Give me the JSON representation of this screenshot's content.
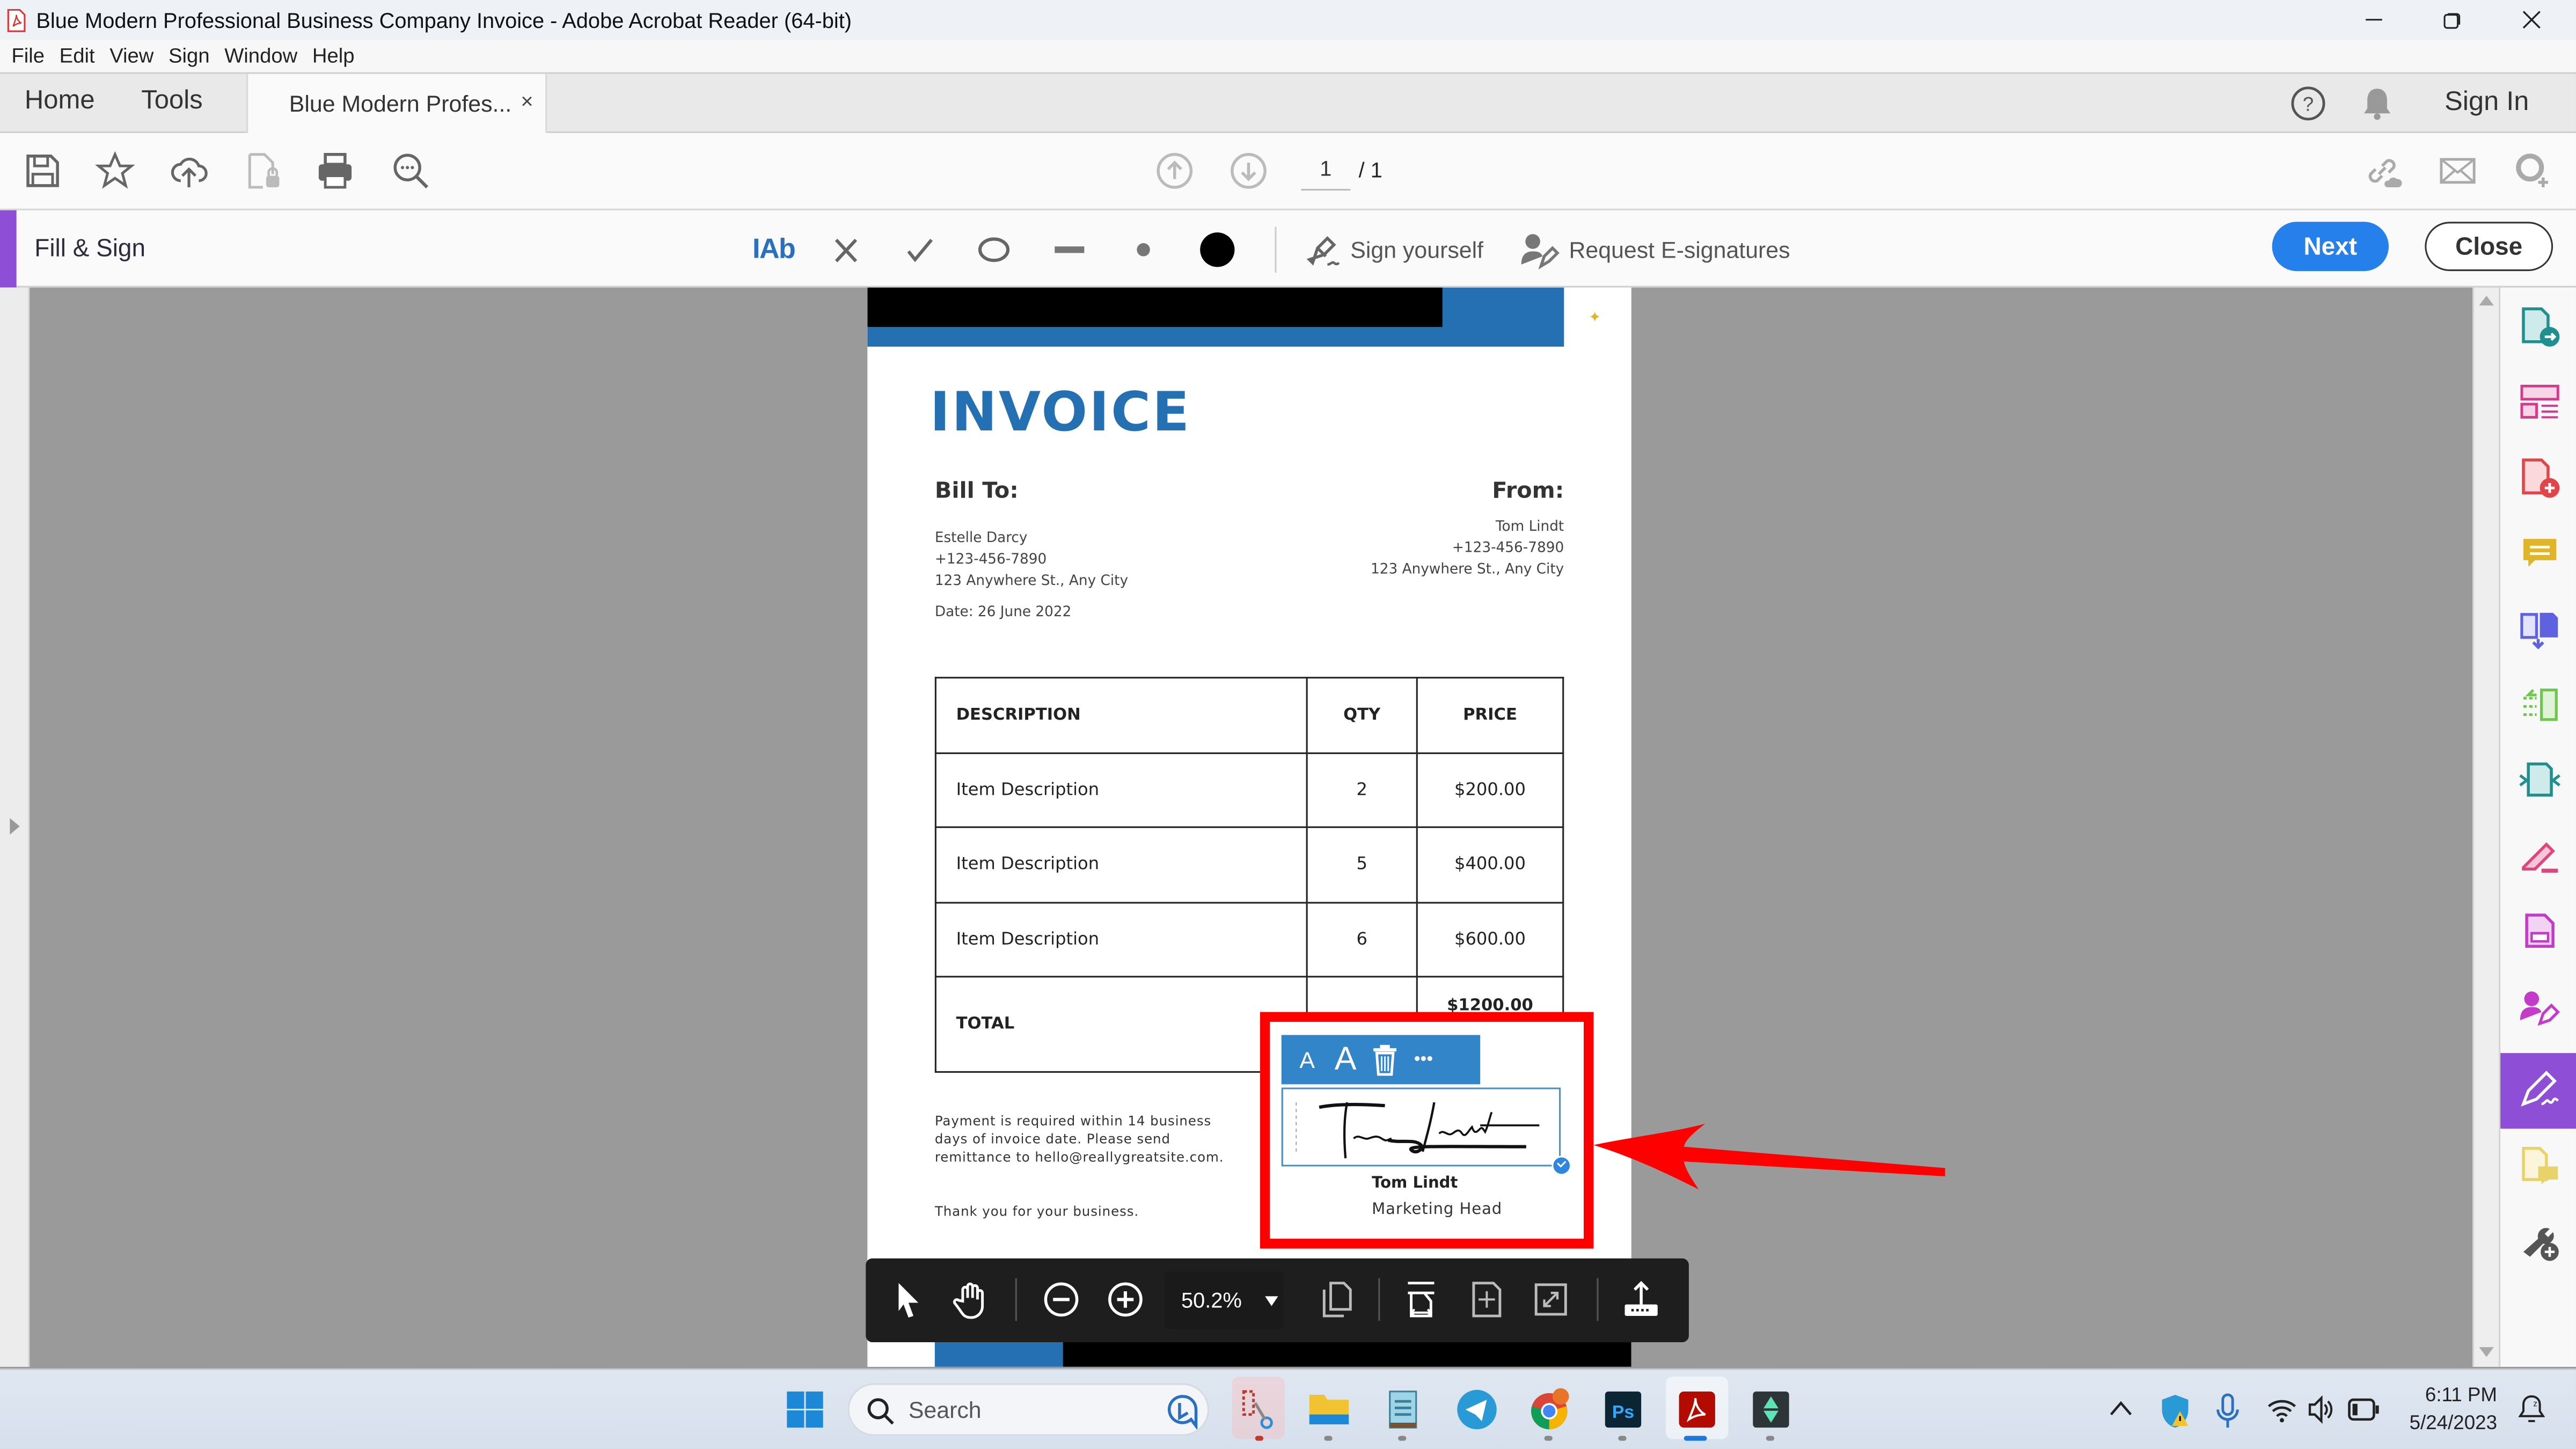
{
  "window": {
    "title": "Blue Modern Professional Business Company Invoice - Adobe Acrobat Reader (64-bit)",
    "controls": [
      "minimize",
      "restore",
      "close"
    ]
  },
  "menu": [
    "File",
    "Edit",
    "View",
    "Sign",
    "Window",
    "Help"
  ],
  "tabs": {
    "home": "Home",
    "tools": "Tools",
    "document": "Blue Modern Profes...",
    "close_glyph": "×",
    "sign_in": "Sign In"
  },
  "toolbar": {
    "left_icons": [
      "save-icon",
      "bookmark-star-icon",
      "upload-cloud-icon",
      "protect-file-icon",
      "print-icon",
      "find-icon"
    ],
    "page_current": "1",
    "page_total": "/ 1",
    "right_icons": [
      "share-link-icon",
      "email-icon",
      "add-user-icon"
    ]
  },
  "fill_sign": {
    "title": "Fill & Sign",
    "tools": [
      "add-text",
      "cross-mark",
      "check-mark",
      "circle",
      "line",
      "dot",
      "color"
    ],
    "text_tool_label": "IAb",
    "sign_yourself": "Sign yourself",
    "request_esignatures": "Request E-signatures",
    "next": "Next",
    "close": "Close",
    "accent_color": "#8e4fd6",
    "next_color": "#2680eb"
  },
  "invoice": {
    "title": "INVOICE",
    "title_color": "#2470b3",
    "bill_to": {
      "heading": "Bill To:",
      "name": "Estelle Darcy",
      "phone": "+123-456-7890",
      "address": "123 Anywhere St., Any City",
      "date": "Date: 26 June 2022"
    },
    "from": {
      "heading": "From:",
      "name": "Tom Lindt",
      "phone": "+123-456-7890",
      "address": "123 Anywhere St., Any City"
    },
    "table": {
      "headers": [
        "DESCRIPTION",
        "QTY",
        "PRICE"
      ],
      "rows": [
        {
          "description": "Item Description",
          "qty": "2",
          "price": "$200.00"
        },
        {
          "description": "Item Description",
          "qty": "5",
          "price": "$400.00"
        },
        {
          "description": "Item Description",
          "qty": "6",
          "price": "$600.00"
        }
      ],
      "total_label": "TOTAL",
      "total_value": "$1200.00"
    },
    "payment_note": "Payment is required within 14 business days of invoice date. Please send remittance to hello@reallygreatsite.com.",
    "thanks": "Thank you for your business.",
    "signature": {
      "script_text": "Tom Lindt",
      "name": "Tom Lindt",
      "role": "Marketing Head",
      "edit_toolbar": [
        "decrease-size-icon",
        "increase-size-icon",
        "delete-icon",
        "more-options-icon"
      ],
      "small_a": "A",
      "large_a": "A",
      "more": "•••"
    }
  },
  "annotation": {
    "highlight_color": "#ff0000"
  },
  "float_toolbar": {
    "zoom": "50.2%",
    "icons": [
      "select-arrow-icon",
      "hand-icon",
      "zoom-out-icon",
      "zoom-in-icon",
      "zoom-dropdown-icon",
      "page-view-icon",
      "fit-width-icon",
      "fit-page-icon",
      "full-screen-icon",
      "share-upload-icon"
    ]
  },
  "right_panel": {
    "items": [
      {
        "name": "export-pdf",
        "color": "#1f8f8f"
      },
      {
        "name": "organize-pages",
        "color": "#d63a8e"
      },
      {
        "name": "create-pdf",
        "color": "#e0454a"
      },
      {
        "name": "comment",
        "color": "#e0b52a"
      },
      {
        "name": "combine-files",
        "color": "#5e62e0"
      },
      {
        "name": "scan-ocr",
        "color": "#6cc84a"
      },
      {
        "name": "compress-pdf",
        "color": "#1f8f8f"
      },
      {
        "name": "edit-pdf",
        "color": "#e0457c"
      },
      {
        "name": "protect",
        "color": "#c43ac9"
      },
      {
        "name": "request-signatures",
        "color": "#c43ac9"
      },
      {
        "name": "fill-and-sign",
        "color": "#8e4fd6",
        "active": true
      },
      {
        "name": "send-for-comments",
        "color": "#e8d36a"
      },
      {
        "name": "more-tools",
        "color": "#555555"
      }
    ]
  },
  "taskbar": {
    "search_placeholder": "Search",
    "apps": [
      "start",
      "snipping-tool",
      "file-explorer",
      "notepad",
      "telegram",
      "chrome",
      "photoshop",
      "acrobat-reader",
      "filmora"
    ],
    "time": "6:11 PM",
    "date": "5/24/2023"
  }
}
